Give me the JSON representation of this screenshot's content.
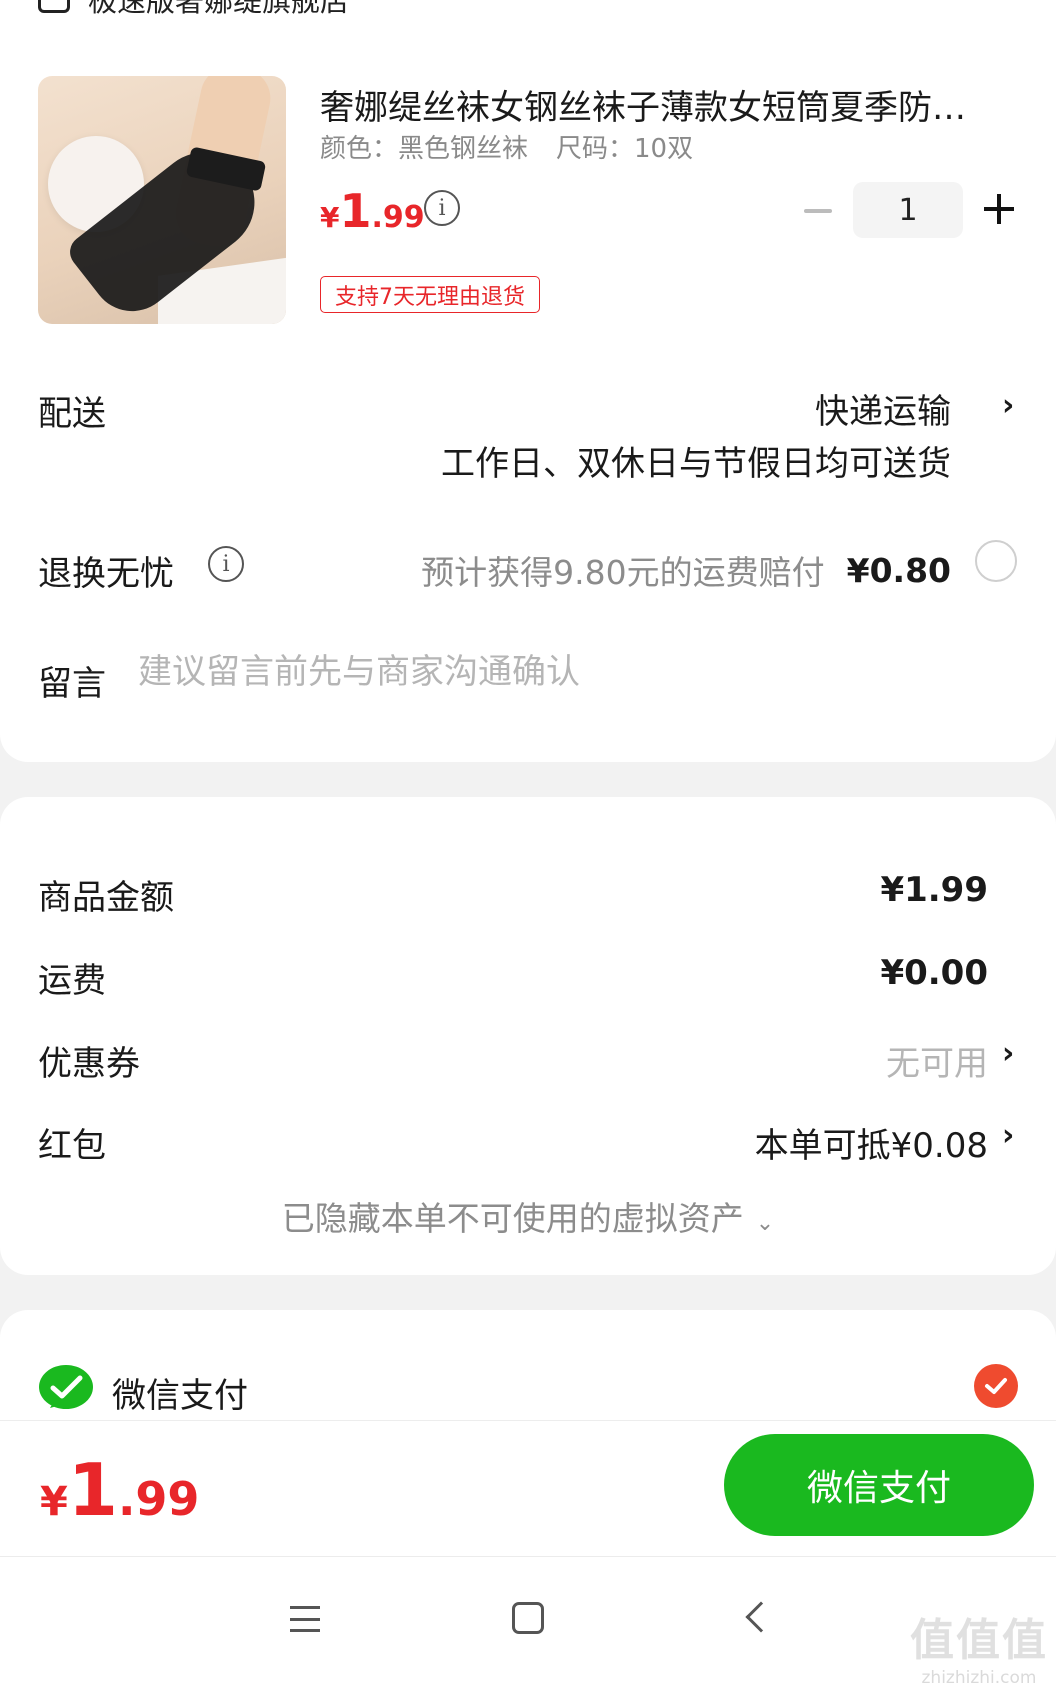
{
  "shop": {
    "name": "极速版奢娜缇旗舰店"
  },
  "product": {
    "title": "奢娜缇丝袜女钢丝袜子薄款女短筒夏季防…",
    "spec_color": "颜色：黑色钢丝袜",
    "spec_size": "尺码：10双",
    "price_yen": "¥",
    "price_int": "1",
    "price_dec": ".99",
    "quantity": "1",
    "return_badge": "支持7天无理由退货"
  },
  "delivery": {
    "label": "配送",
    "method": "快递运输",
    "note": "工作日、双休日与节假日均可送货"
  },
  "insurance": {
    "label": "退换无忧",
    "desc": "预计获得9.80元的运费赔付",
    "amount": "¥0.80"
  },
  "message": {
    "label": "留言",
    "placeholder": "建议留言前先与商家沟通确认"
  },
  "summary": {
    "goods_label": "商品金额",
    "goods_value": "¥1.99",
    "shipping_label": "运费",
    "shipping_value": "¥0.00",
    "coupon_label": "优惠券",
    "coupon_value": "无可用",
    "redpacket_label": "红包",
    "redpacket_value": "本单可抵¥0.08",
    "hidden_assets": "已隐藏本单不可使用的虚拟资产"
  },
  "payment": {
    "method": "微信支付",
    "brand_color": "#1ab91f",
    "selected_color": "#ef4b2f"
  },
  "footer": {
    "total_yen": "¥",
    "total_int": "1",
    "total_dec": ".99",
    "pay_button": "微信支付",
    "price_color": "#e8262a"
  },
  "watermark": {
    "big": "值值值",
    "small": "zhizhizhi.com"
  },
  "icons": [
    "shop-icon",
    "info-icon",
    "chevron-right-icon",
    "chevron-down-icon",
    "wechat-pay-icon",
    "check-icon",
    "menu-icon",
    "home-icon",
    "back-icon"
  ]
}
